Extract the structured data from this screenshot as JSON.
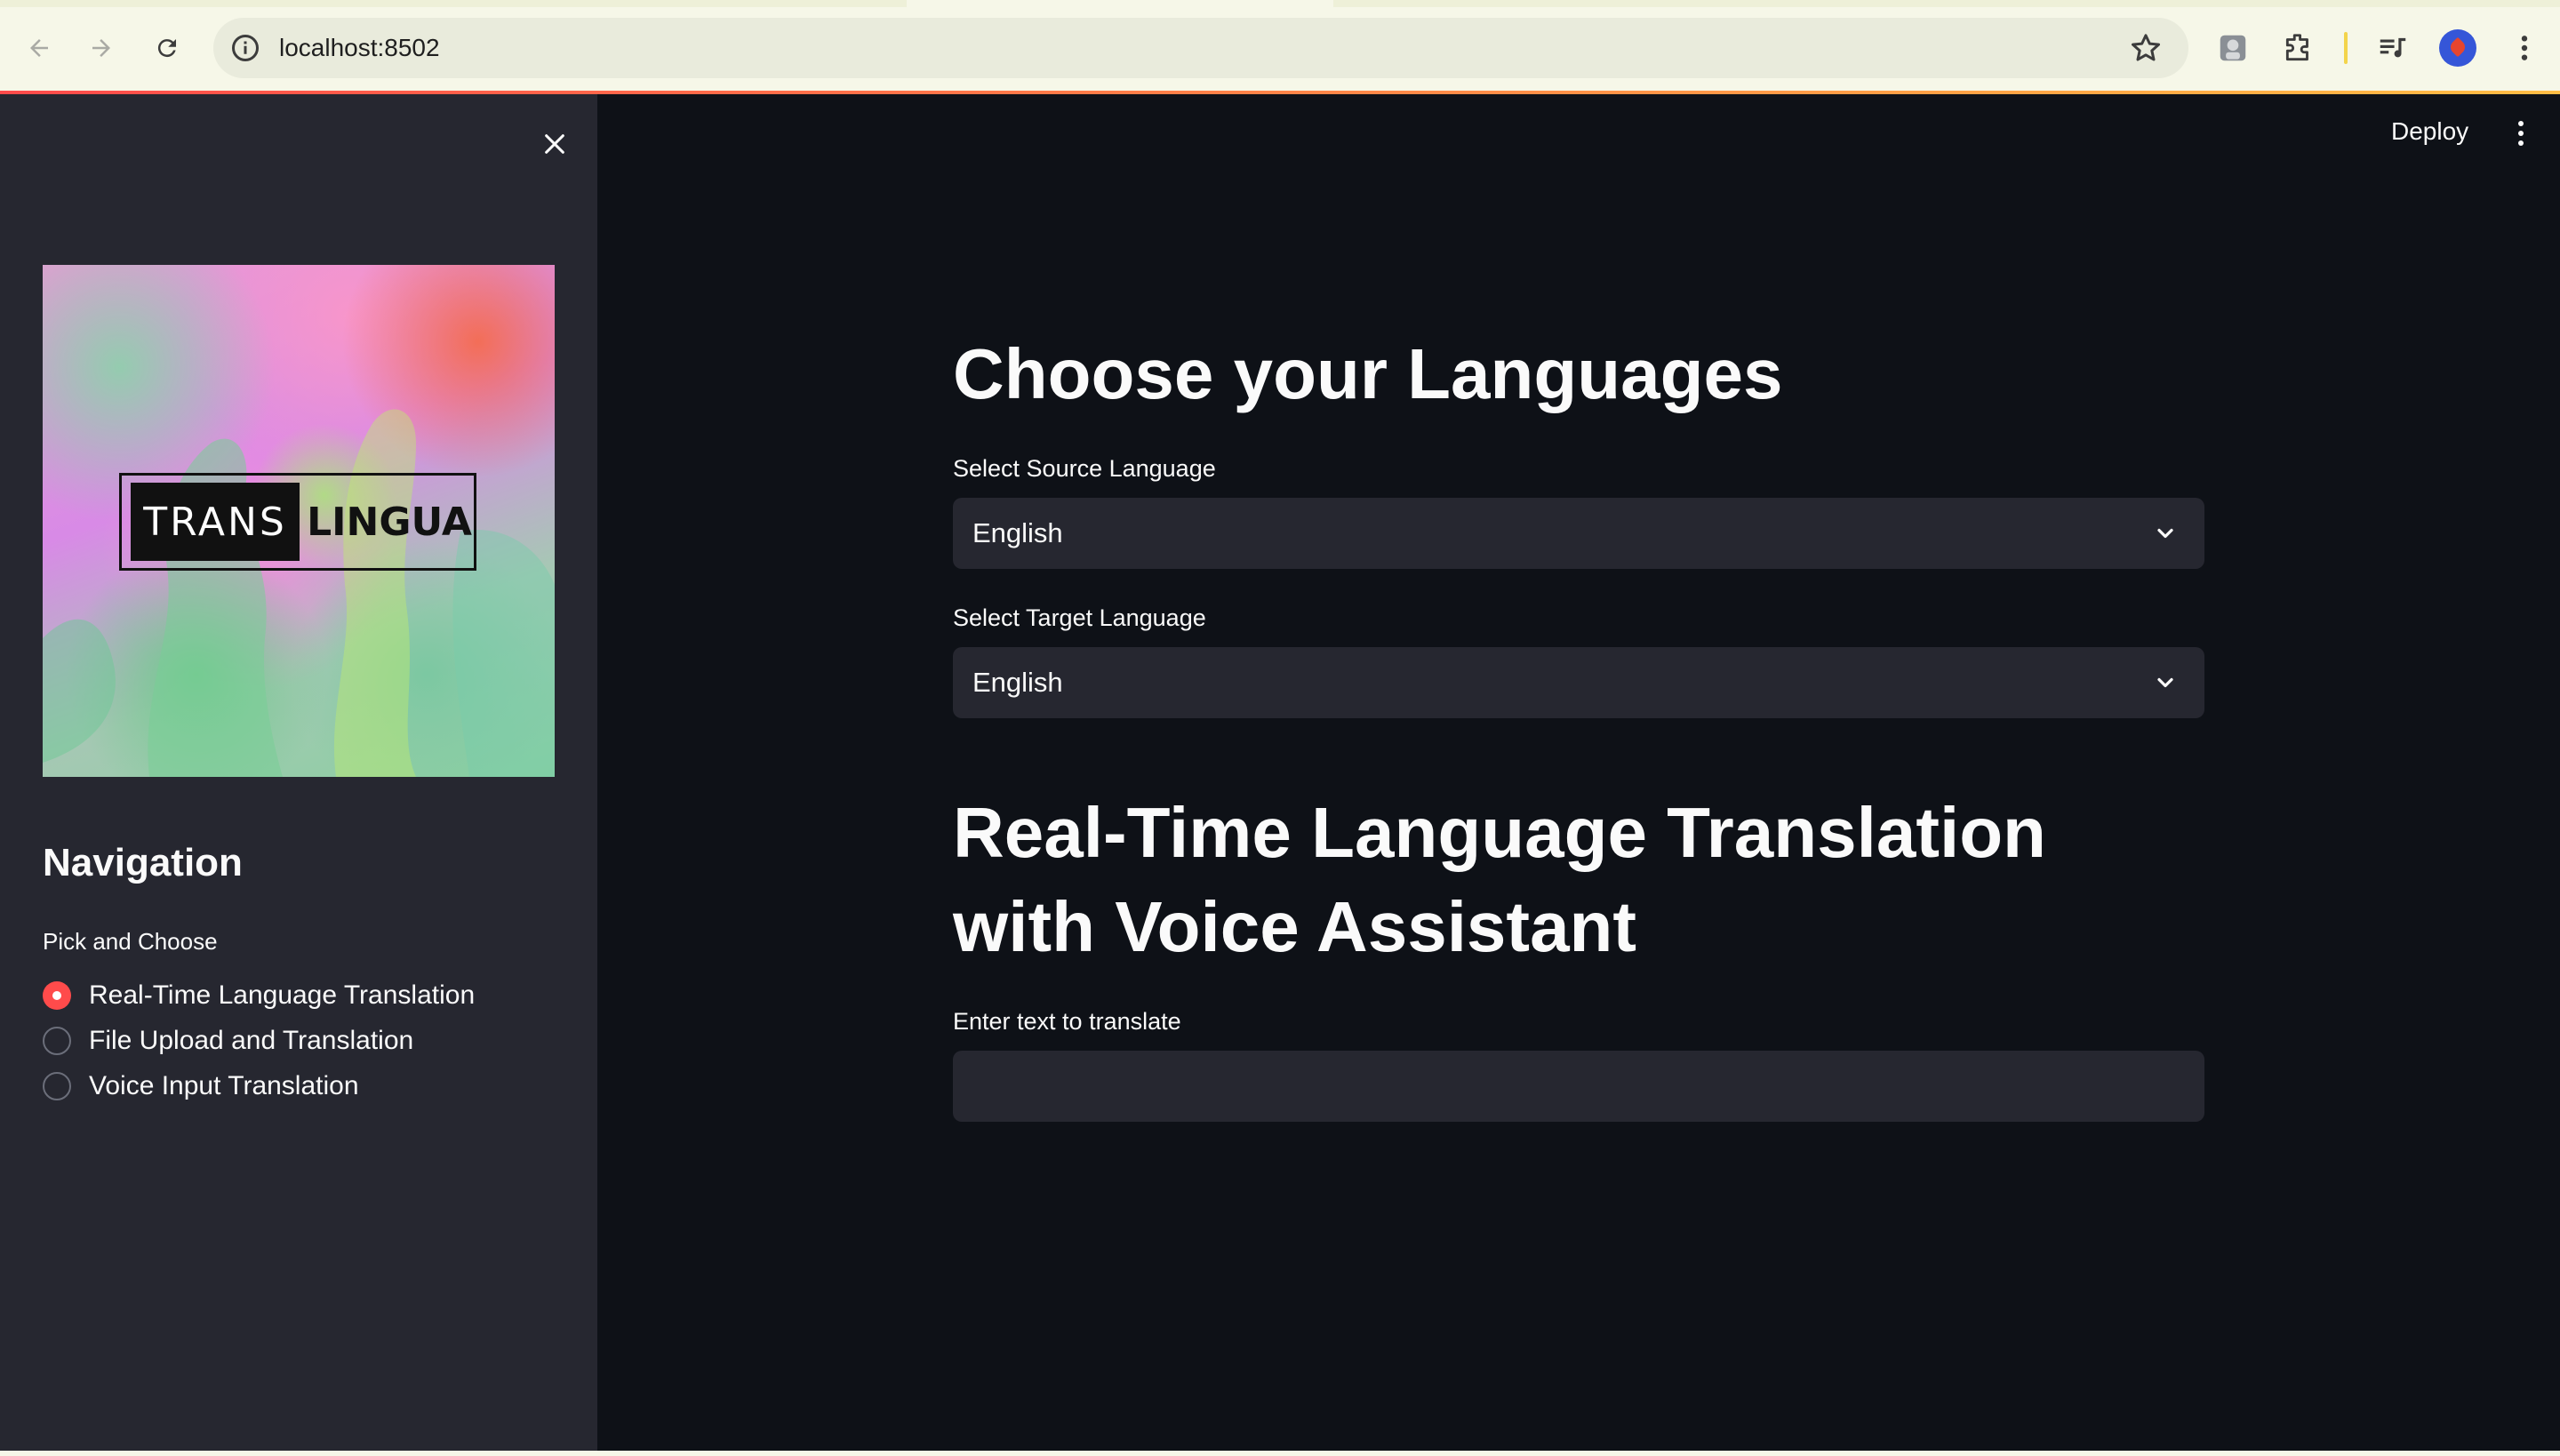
{
  "browser": {
    "url": "localhost:8502",
    "accent_colors": [
      "#ff4b4b",
      "#ffbd45"
    ]
  },
  "sidebar": {
    "logo": {
      "word1": "TRANS",
      "word2": "LINGUA"
    },
    "nav_title": "Navigation",
    "radio_label": "Pick and Choose",
    "options": [
      {
        "label": "Real-Time Language Translation",
        "selected": true
      },
      {
        "label": "File Upload and Translation",
        "selected": false
      },
      {
        "label": "Voice Input Translation",
        "selected": false
      }
    ]
  },
  "header": {
    "deploy_label": "Deploy"
  },
  "main": {
    "languages_heading": "Choose your Languages",
    "source": {
      "label": "Select Source Language",
      "value": "English"
    },
    "target": {
      "label": "Select Target Language",
      "value": "English"
    },
    "translate_heading_line1": "Real-Time Language Translation",
    "translate_heading_line2": "with Voice Assistant",
    "text_input": {
      "label": "Enter text to translate",
      "value": "",
      "placeholder": ""
    }
  }
}
